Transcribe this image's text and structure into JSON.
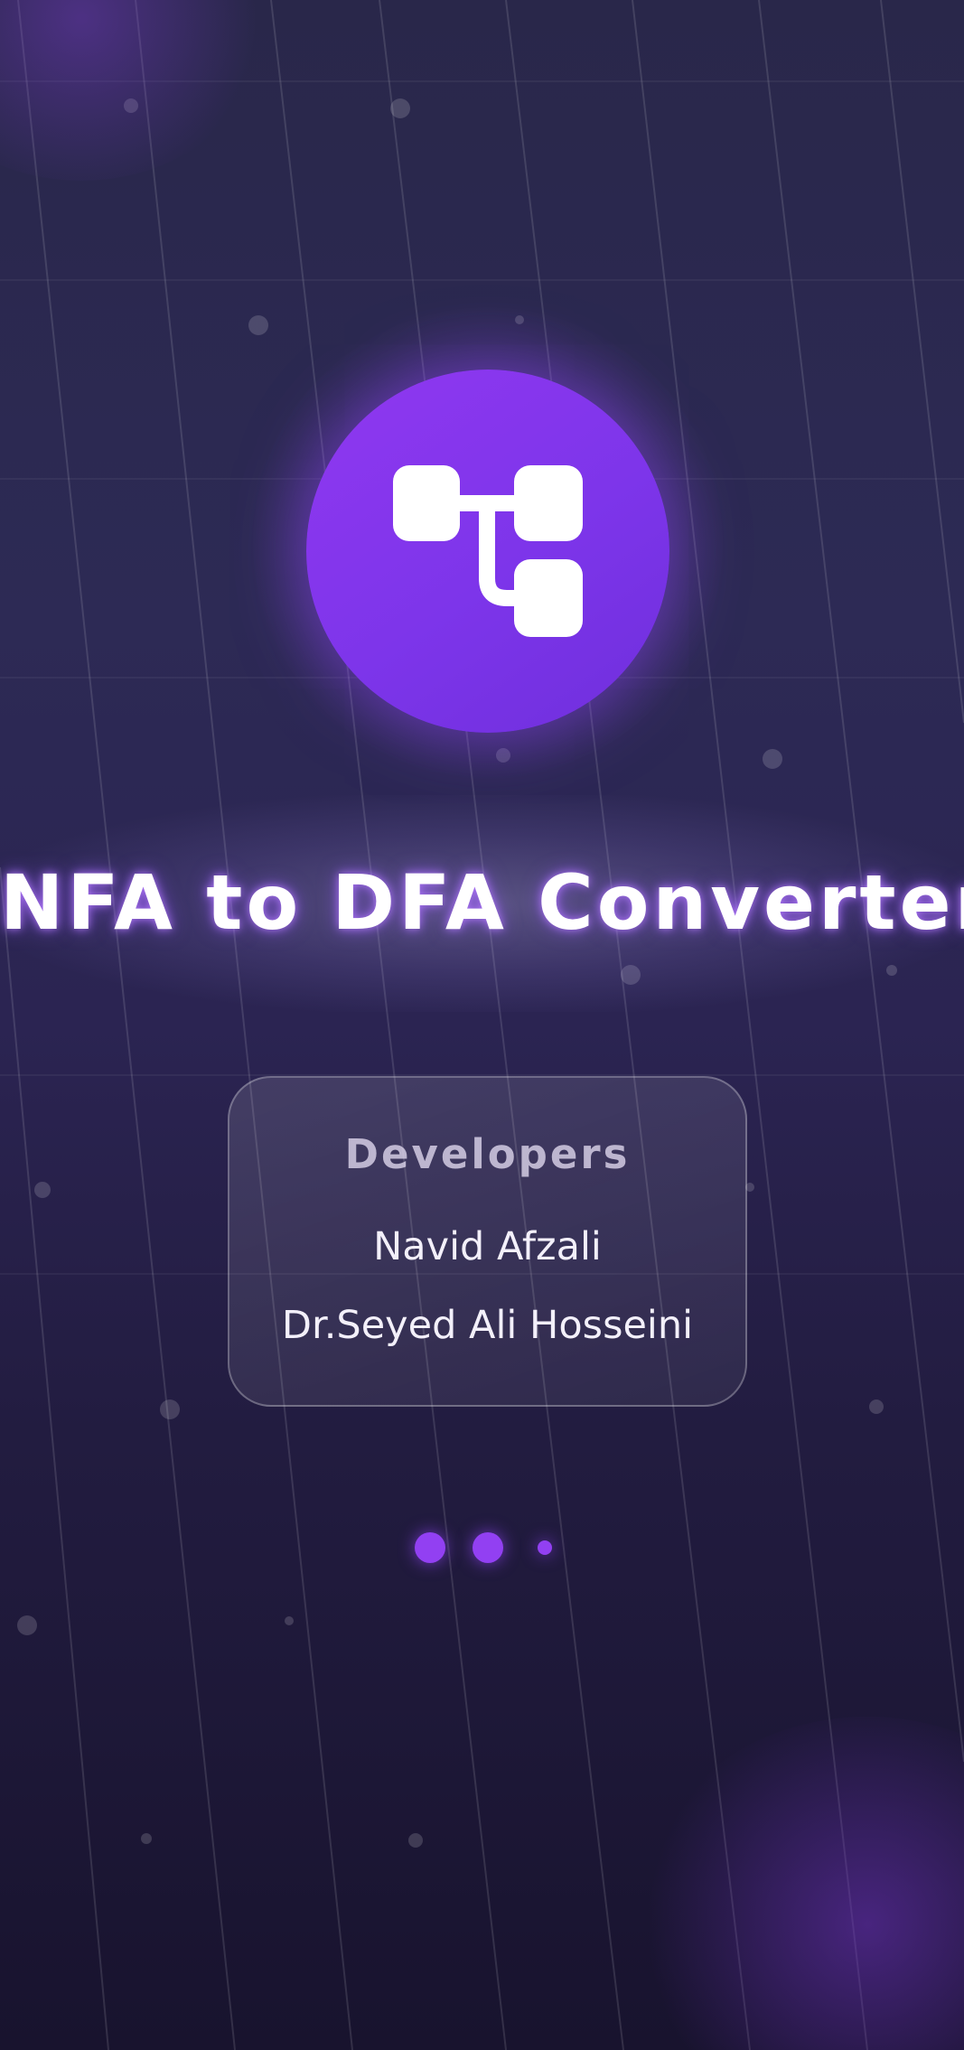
{
  "app": {
    "title": "NFA to DFA Converter",
    "logo_icon": "tree-diagram-icon"
  },
  "developers": {
    "heading": "Developers",
    "names": [
      "Navid Afzali",
      "Dr.Seyed Ali Hosseini"
    ]
  },
  "loading_indicator": {
    "dot_count": 3,
    "active_dot": 3
  },
  "colors": {
    "accent": "#8b3cf0",
    "background_top": "#29274a",
    "background_bottom": "#18132e",
    "text": "#ffffff"
  }
}
